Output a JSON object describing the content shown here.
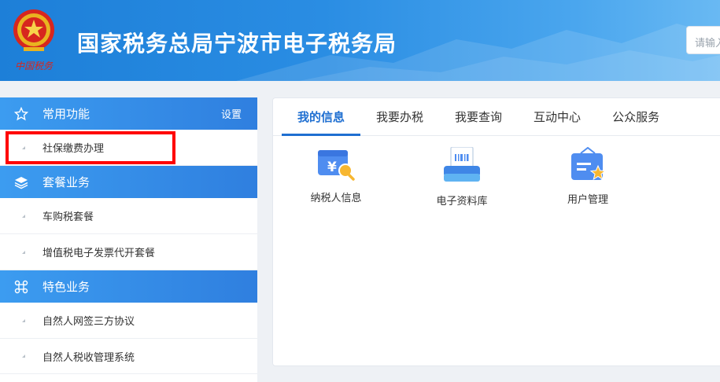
{
  "header": {
    "title": "国家税务总局宁波市电子税务局",
    "search_placeholder": "请输入",
    "emblem_text": "中国税务"
  },
  "sidebar": {
    "sections": [
      {
        "label": "常用功能",
        "icon": "star-icon",
        "action": "设置",
        "items": [
          {
            "label": "社保缴费办理"
          }
        ]
      },
      {
        "label": "套餐业务",
        "icon": "layers-icon",
        "items": [
          {
            "label": "车购税套餐"
          },
          {
            "label": "增值税电子发票代开套餐"
          }
        ]
      },
      {
        "label": "特色业务",
        "icon": "command-icon",
        "items": [
          {
            "label": "自然人网签三方协议"
          },
          {
            "label": "自然人税收管理系统"
          }
        ]
      }
    ]
  },
  "main": {
    "tabs": [
      "我的信息",
      "我要办税",
      "我要查询",
      "互动中心",
      "公众服务"
    ],
    "active_tab": 0,
    "services": [
      {
        "label": "纳税人信息",
        "icon": "taxpayer-info-icon"
      },
      {
        "label": "电子资料库",
        "icon": "document-library-icon"
      },
      {
        "label": "用户管理",
        "icon": "user-management-icon"
      }
    ]
  },
  "colors": {
    "primary": "#1f6fd1",
    "header": "#2a8de3",
    "highlight": "#ff0000"
  }
}
